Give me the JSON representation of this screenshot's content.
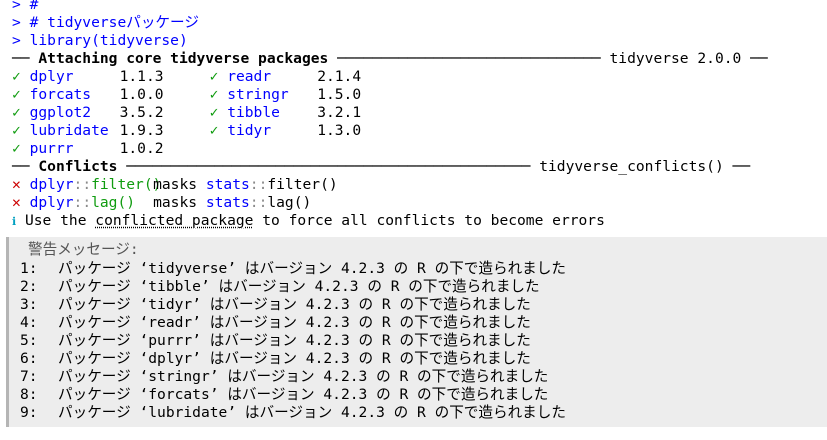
{
  "prompt": ">",
  "commands": [
    {
      "text": "#"
    },
    {
      "text": "# tidyverseパッケージ"
    },
    {
      "text": "library(tidyverse)"
    }
  ],
  "attach_header": {
    "dash_lead": "──",
    "title": "Attaching core tidyverse packages",
    "rule": "──────────────────────────────",
    "version": "tidyverse 2.0.0",
    "dash_tail": "──"
  },
  "check_mark": "✓",
  "cross_mark": "✕",
  "info_mark": "ℹ",
  "packages": [
    {
      "name": "dplyr",
      "version": "1.1.3"
    },
    {
      "name": "forcats",
      "version": "1.0.0"
    },
    {
      "name": "ggplot2",
      "version": "3.5.2"
    },
    {
      "name": "lubridate",
      "version": "1.9.3"
    },
    {
      "name": "purrr",
      "version": "1.0.2"
    },
    {
      "name": "readr",
      "version": "2.1.4"
    },
    {
      "name": "stringr",
      "version": "1.5.0"
    },
    {
      "name": "tibble",
      "version": "3.2.1"
    },
    {
      "name": "tidyr",
      "version": "1.3.0"
    }
  ],
  "conflicts_header": {
    "dash_lead": "──",
    "title": "Conflicts",
    "rule": "──────────────────────────────────────────────",
    "name": "tidyverse_conflicts()",
    "dash_tail": "──"
  },
  "conflicts": [
    {
      "pkg": "dplyr",
      "sep": "::",
      "fn": "filter()",
      "masks": "masks",
      "mpkg": "stats",
      "mfn": "filter()"
    },
    {
      "pkg": "dplyr",
      "sep": "::",
      "fn": "lag()",
      "masks": "masks",
      "mpkg": "stats",
      "mfn": "lag()"
    }
  ],
  "info": {
    "before": "Use the ",
    "link": "conflicted package",
    "after": " to force all conflicts to become errors"
  },
  "warning": {
    "title": "警告メッセージ:",
    "items": [
      {
        "num": "1:",
        "text": "パッケージ ‘tidyverse’ はバージョン 4.2.3 の R の下で造られました"
      },
      {
        "num": "2:",
        "text": "パッケージ ‘tibble’ はバージョン 4.2.3 の R の下で造られました"
      },
      {
        "num": "3:",
        "text": "パッケージ ‘tidyr’ はバージョン 4.2.3 の R の下で造られました"
      },
      {
        "num": "4:",
        "text": "パッケージ ‘readr’ はバージョン 4.2.3 の R の下で造られました"
      },
      {
        "num": "5:",
        "text": "パッケージ ‘purrr’ はバージョン 4.2.3 の R の下で造られました"
      },
      {
        "num": "6:",
        "text": "パッケージ ‘dplyr’ はバージョン 4.2.3 の R の下で造られました"
      },
      {
        "num": "7:",
        "text": "パッケージ ‘stringr’ はバージョン 4.2.3 の R の下で造られました"
      },
      {
        "num": "8:",
        "text": "パッケージ ‘forcats’ はバージョン 4.2.3 の R の下で造られました"
      },
      {
        "num": "9:",
        "text": "パッケージ ‘lubridate’ はバージョン 4.2.3 の R の下で造られました"
      }
    ]
  }
}
